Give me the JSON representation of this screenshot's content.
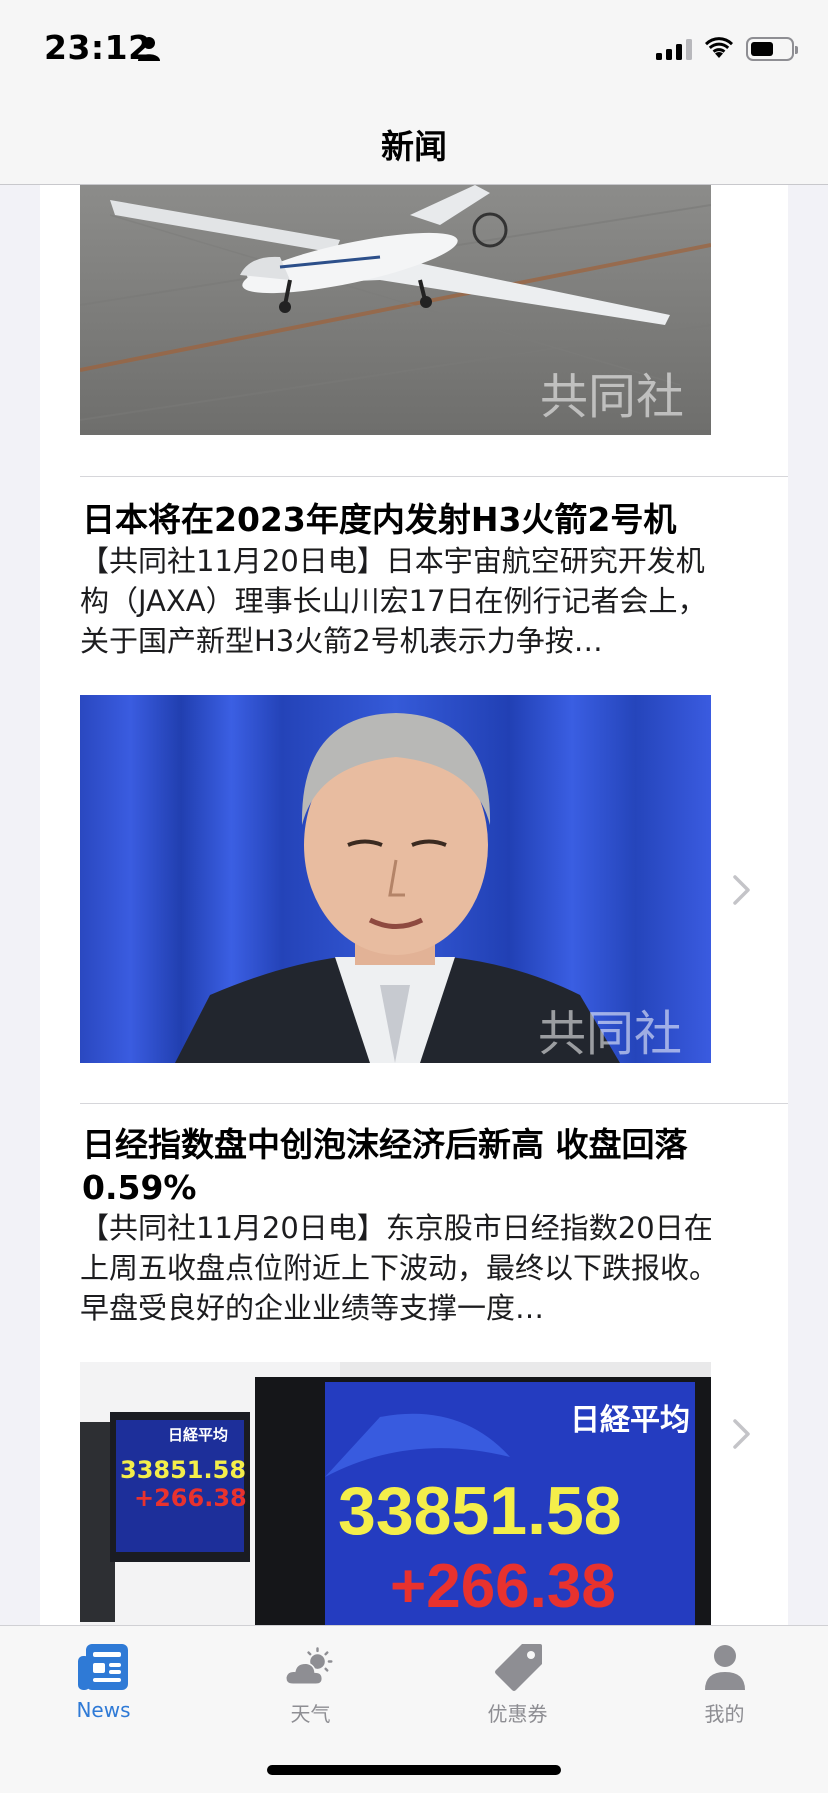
{
  "status_bar": {
    "time": "23:12"
  },
  "nav": {
    "title": "新闻"
  },
  "articles": [
    {
      "headline": "日本将在2023年度内发射H3火箭2号机",
      "summary": "【共同社11月20日电】日本宇宙航空研究开发机构（JAXA）理事长山川宏17日在例行记者会上，关于国产新型H3火箭2号机表示力争按…"
    },
    {
      "headline": "日经指数盘中创泡沫经济后新高 收盘回落0.59%",
      "summary": "【共同社11月20日电】东京股市日经指数20日在上周五收盘点位附近上下波动，最终以下跌报收。早盘受良好的企业业绩等支撑一度…"
    }
  ],
  "images": {
    "watermark": "共同社",
    "board_small_title": "日経平均",
    "board_small_value": "33851.58",
    "board_small_change": "+266.38",
    "board_large_title": "日経平均",
    "board_large_value": "33851.58",
    "board_large_change": "+266.38"
  },
  "tabs": [
    {
      "label": "News",
      "icon": "newspaper-icon",
      "active": true
    },
    {
      "label": "天气",
      "icon": "cloud-sun-icon",
      "active": false
    },
    {
      "label": "优惠券",
      "icon": "tag-icon",
      "active": false
    },
    {
      "label": "我的",
      "icon": "person-icon",
      "active": false
    }
  ],
  "colors": {
    "accent": "#2f7ad6",
    "inactive": "#8e8e93",
    "board_value": "#f4ee4a",
    "board_change": "#e8322e"
  }
}
